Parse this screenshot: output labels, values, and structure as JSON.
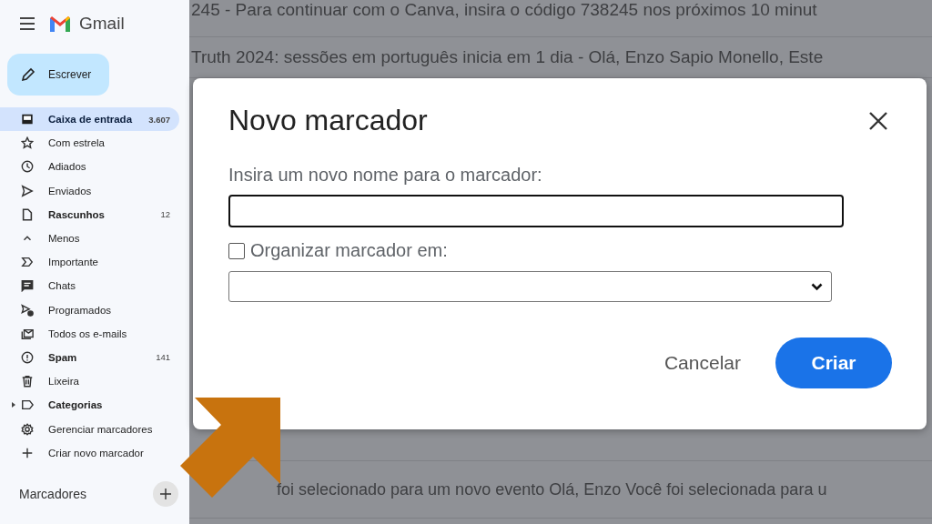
{
  "sidebar": {
    "app_name": "Gmail",
    "compose": "Escrever",
    "nav_items": [
      {
        "label": "Caixa de entrada",
        "count": "3.607",
        "unread": true,
        "selected": true,
        "kind": "link"
      },
      {
        "label": "Com estrela",
        "unread": false,
        "selected": false,
        "kind": "link"
      },
      {
        "label": "Adiados",
        "unread": false,
        "selected": false,
        "kind": "link"
      },
      {
        "label": "Enviados",
        "unread": false,
        "selected": false,
        "kind": "link"
      },
      {
        "label": "Rascunhos",
        "count": "12",
        "unread": true,
        "selected": false,
        "kind": "link"
      },
      {
        "label": "Menos",
        "unread": false,
        "selected": false,
        "kind": "link"
      },
      {
        "label": "Importante",
        "unread": false,
        "selected": false,
        "kind": "link"
      },
      {
        "label": "Chats",
        "unread": false,
        "selected": false,
        "kind": "link"
      },
      {
        "label": "Programados",
        "unread": false,
        "selected": false,
        "kind": "link"
      },
      {
        "label": "Todos os e-mails",
        "unread": false,
        "selected": false,
        "kind": "link"
      },
      {
        "label": "Spam",
        "count": "141",
        "unread": true,
        "selected": false,
        "kind": "link"
      },
      {
        "label": "Lixeira",
        "unread": false,
        "selected": false,
        "kind": "link"
      },
      {
        "label": "Categorias",
        "unread": true,
        "selected": false,
        "kind": "folder"
      },
      {
        "label": "Gerenciar marcadores",
        "unread": false,
        "selected": false,
        "kind": "link"
      },
      {
        "label": "Criar novo marcador",
        "unread": false,
        "selected": false,
        "kind": "link"
      }
    ],
    "labels_heading": "Marcadores"
  },
  "email_rows": [
    "245 - Para continuar com o Canva, insira o código 738245 nos próximos 10 minut",
    "Truth 2024: sessões em português inicia em 1 dia - Olá, Enzo Sapio Monello, Este",
    "foi selecionado para um novo evento Olá, Enzo Você foi selecionada para u"
  ],
  "dialog": {
    "title": "Novo marcador",
    "field_label": "Insira um novo nome para o marcador:",
    "name_field": {
      "focused": true
    },
    "nest_checkbox": {
      "label": "Organizar marcador em:",
      "checked": false
    },
    "buttons": [
      {
        "label": "Cancelar",
        "kind": "text"
      },
      {
        "label": "Criar",
        "kind": "filled"
      }
    ]
  }
}
